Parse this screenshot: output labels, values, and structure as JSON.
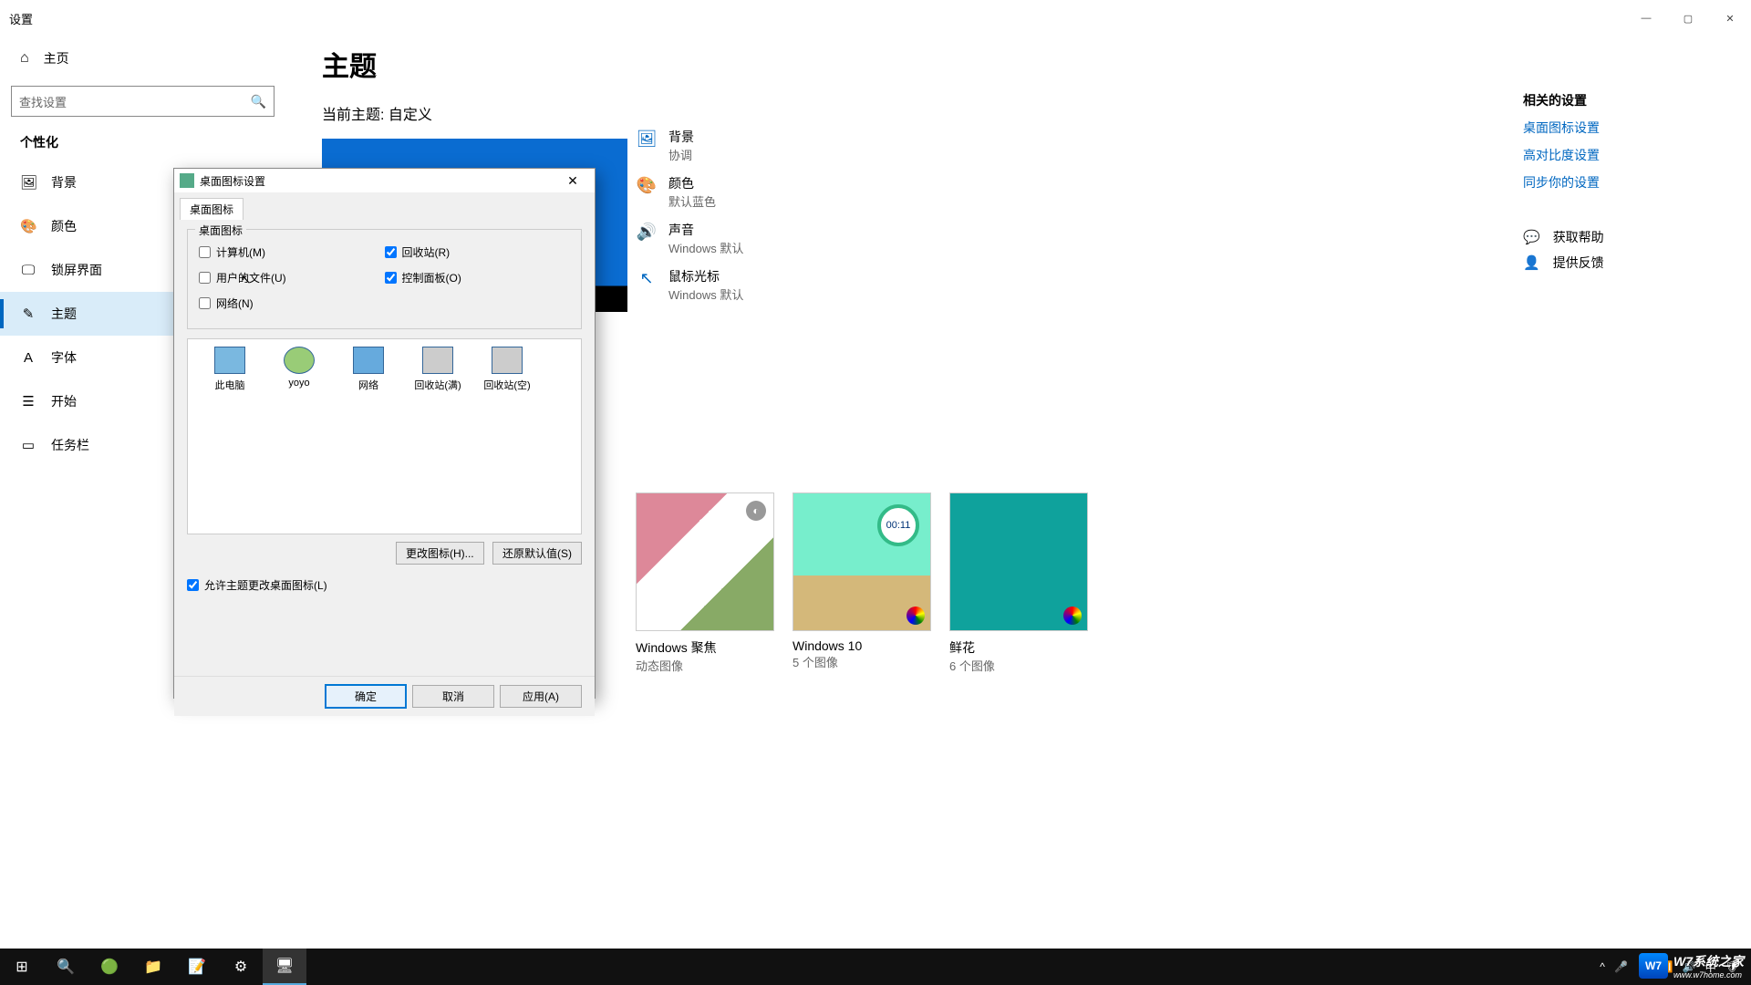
{
  "window": {
    "title": "设置"
  },
  "sidebar": {
    "home": "主页",
    "search_placeholder": "查找设置",
    "section": "个性化",
    "items": [
      {
        "label": "背景"
      },
      {
        "label": "颜色"
      },
      {
        "label": "锁屏界面"
      },
      {
        "label": "主题"
      },
      {
        "label": "字体"
      },
      {
        "label": "开始"
      },
      {
        "label": "任务栏"
      }
    ]
  },
  "main": {
    "title": "主题",
    "current": "当前主题: 自定义",
    "props": [
      {
        "title": "背景",
        "value": "协调"
      },
      {
        "title": "颜色",
        "value": "默认蓝色"
      },
      {
        "title": "声音",
        "value": "Windows 默认"
      },
      {
        "title": "鼠标光标",
        "value": "Windows 默认"
      }
    ],
    "themes": [
      {
        "name": "Windows 聚焦",
        "sub": "动态图像"
      },
      {
        "name": "Windows 10",
        "sub": "5 个图像",
        "timer": "00:11"
      },
      {
        "name": "鲜花",
        "sub": "6 个图像"
      }
    ]
  },
  "rightcol": {
    "heading": "相关的设置",
    "links": [
      "桌面图标设置",
      "高对比度设置",
      "同步你的设置"
    ],
    "help": "获取帮助",
    "feedback": "提供反馈"
  },
  "dialog": {
    "title": "桌面图标设置",
    "tab": "桌面图标",
    "legend": "桌面图标",
    "checks": {
      "computer": "计算机(M)",
      "userfiles": "用户的文件(U)",
      "network": "网络(N)",
      "recycle": "回收站(R)",
      "cpanel": "控制面板(O)"
    },
    "icons": [
      "此电脑",
      "yoyo",
      "网络",
      "回收站(满)",
      "回收站(空)"
    ],
    "change": "更改图标(H)...",
    "restore": "还原默认值(S)",
    "allow": "允许主题更改桌面图标(L)",
    "ok": "确定",
    "cancel": "取消",
    "apply": "应用(A)"
  },
  "watermark": {
    "text": "W7系统之家",
    "sub": "www.w7home.com"
  }
}
